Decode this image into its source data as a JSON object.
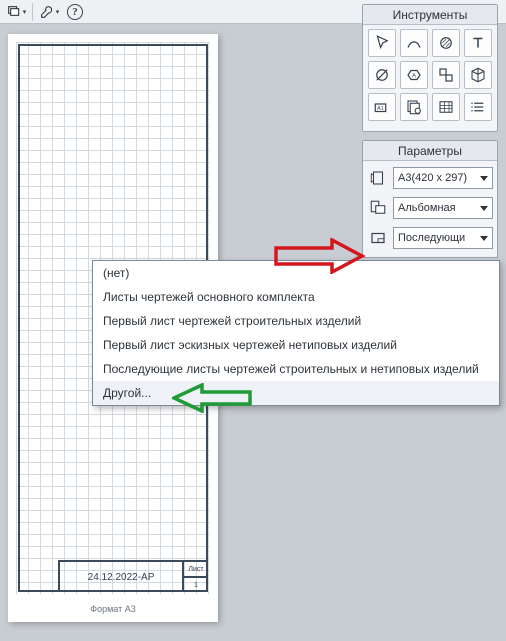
{
  "topbar": {
    "btn_stack": "stack-icon",
    "btn_wrench": "wrench-icon",
    "btn_help": "?"
  },
  "canvas": {
    "date_label": "24.12.2022-АР",
    "side_top": "Лист",
    "side_bottom": "1",
    "footer": "Формат   A3"
  },
  "instruments": {
    "title": "Инструменты"
  },
  "params": {
    "title": "Параметры",
    "size_value": "A3(420 x 297)",
    "orient_value": "Альбомная",
    "template_value": "Последующи"
  },
  "dropdown": {
    "items": [
      "(нет)",
      "Листы чертежей основного комплекта",
      "Первый лист чертежей строительных изделий",
      "Первый лист эскизных чертежей нетиповых изделий",
      "Последующие листы чертежей строительных и нетиповых изделий",
      "Другой..."
    ]
  }
}
